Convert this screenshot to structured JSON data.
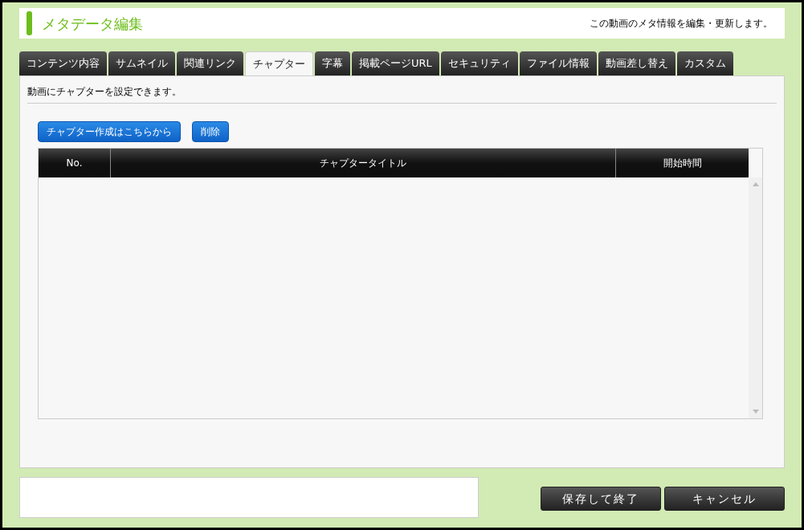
{
  "header": {
    "title": "メタデータ編集",
    "description": "この動画のメタ情報を編集・更新します。"
  },
  "tabs": [
    {
      "label": "コンテンツ内容",
      "selected": false
    },
    {
      "label": "サムネイル",
      "selected": false
    },
    {
      "label": "関連リンク",
      "selected": false
    },
    {
      "label": "チャプター",
      "selected": true
    },
    {
      "label": "字幕",
      "selected": false
    },
    {
      "label": "掲載ページURL",
      "selected": false
    },
    {
      "label": "セキュリティ",
      "selected": false
    },
    {
      "label": "ファイル情報",
      "selected": false
    },
    {
      "label": "動画差し替え",
      "selected": false
    },
    {
      "label": "カスタム",
      "selected": false
    }
  ],
  "panel": {
    "description": "動画にチャプターを設定できます。",
    "buttons": [
      "チャプター作成はこちらから",
      "削除"
    ],
    "table": {
      "columns": [
        "No.",
        "チャプタータイトル",
        "開始時間"
      ]
    }
  },
  "footer": {
    "buttons": [
      "保存して終了",
      "キャンセル"
    ]
  }
}
